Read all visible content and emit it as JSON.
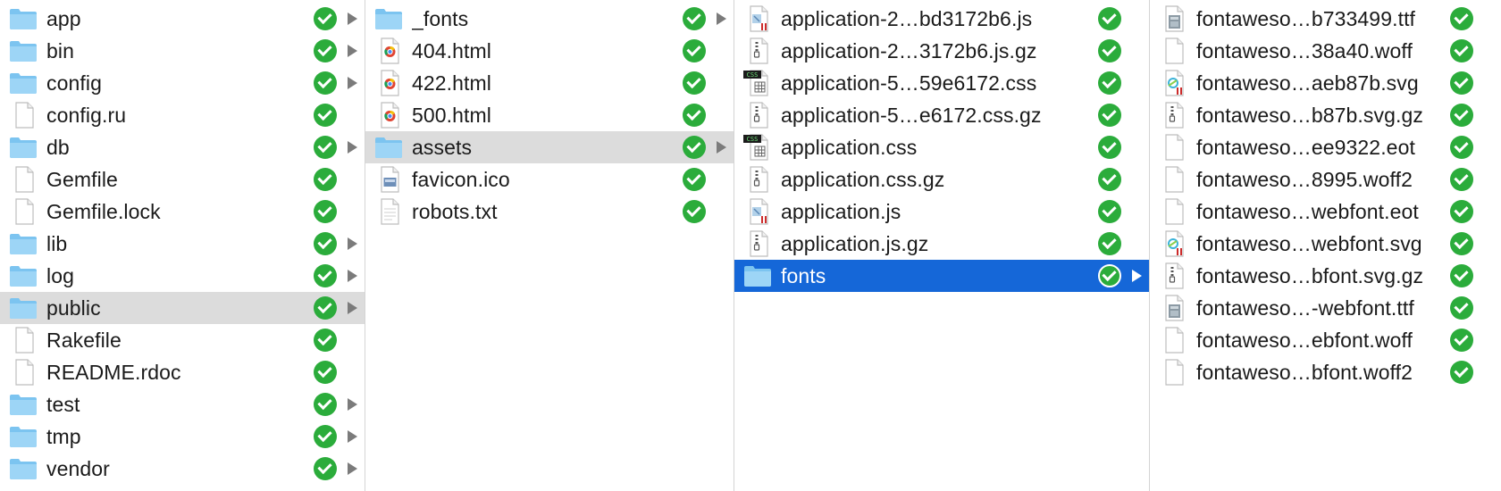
{
  "colors": {
    "folder": "#7cc4f0",
    "check": "#2bac3b",
    "selection_blue": "#1567d8",
    "selection_gray": "#dcdcdc"
  },
  "columns": [
    {
      "items": [
        {
          "name": "app",
          "kind": "folder",
          "arrow": true,
          "state": ""
        },
        {
          "name": "bin",
          "kind": "folder",
          "arrow": true,
          "state": ""
        },
        {
          "name": "config",
          "kind": "folder",
          "arrow": true,
          "state": ""
        },
        {
          "name": "config.ru",
          "kind": "file",
          "arrow": false,
          "state": ""
        },
        {
          "name": "db",
          "kind": "folder",
          "arrow": true,
          "state": ""
        },
        {
          "name": "Gemfile",
          "kind": "file",
          "arrow": false,
          "state": ""
        },
        {
          "name": "Gemfile.lock",
          "kind": "file",
          "arrow": false,
          "state": ""
        },
        {
          "name": "lib",
          "kind": "folder",
          "arrow": true,
          "state": ""
        },
        {
          "name": "log",
          "kind": "folder",
          "arrow": true,
          "state": ""
        },
        {
          "name": "public",
          "kind": "folder",
          "arrow": true,
          "state": "gray"
        },
        {
          "name": "Rakefile",
          "kind": "file",
          "arrow": false,
          "state": ""
        },
        {
          "name": "README.rdoc",
          "kind": "file",
          "arrow": false,
          "state": ""
        },
        {
          "name": "test",
          "kind": "folder",
          "arrow": true,
          "state": ""
        },
        {
          "name": "tmp",
          "kind": "folder",
          "arrow": true,
          "state": ""
        },
        {
          "name": "vendor",
          "kind": "folder",
          "arrow": true,
          "state": ""
        }
      ]
    },
    {
      "items": [
        {
          "name": "_fonts",
          "kind": "folder",
          "arrow": true,
          "state": ""
        },
        {
          "name": "404.html",
          "kind": "html",
          "arrow": false,
          "state": ""
        },
        {
          "name": "422.html",
          "kind": "html",
          "arrow": false,
          "state": ""
        },
        {
          "name": "500.html",
          "kind": "html",
          "arrow": false,
          "state": ""
        },
        {
          "name": "assets",
          "kind": "folder",
          "arrow": true,
          "state": "gray"
        },
        {
          "name": "favicon.ico",
          "kind": "ico",
          "arrow": false,
          "state": ""
        },
        {
          "name": "robots.txt",
          "kind": "txt",
          "arrow": false,
          "state": ""
        }
      ]
    },
    {
      "items": [
        {
          "name": "application-2…bd3172b6.js",
          "kind": "js",
          "arrow": false,
          "state": ""
        },
        {
          "name": "application-2…3172b6.js.gz",
          "kind": "gz",
          "arrow": false,
          "state": ""
        },
        {
          "name": "application-5…59e6172.css",
          "kind": "css",
          "arrow": false,
          "state": ""
        },
        {
          "name": "application-5…e6172.css.gz",
          "kind": "gz",
          "arrow": false,
          "state": ""
        },
        {
          "name": "application.css",
          "kind": "css",
          "arrow": false,
          "state": ""
        },
        {
          "name": "application.css.gz",
          "kind": "gz",
          "arrow": false,
          "state": ""
        },
        {
          "name": "application.js",
          "kind": "js",
          "arrow": false,
          "state": ""
        },
        {
          "name": "application.js.gz",
          "kind": "gz",
          "arrow": false,
          "state": ""
        },
        {
          "name": "fonts",
          "kind": "folder",
          "arrow": true,
          "state": "blue"
        }
      ]
    },
    {
      "items": [
        {
          "name": "fontaweso…b733499.ttf",
          "kind": "ttf",
          "arrow": false,
          "state": ""
        },
        {
          "name": "fontaweso…38a40.woff",
          "kind": "file",
          "arrow": false,
          "state": ""
        },
        {
          "name": "fontaweso…aeb87b.svg",
          "kind": "svg",
          "arrow": false,
          "state": ""
        },
        {
          "name": "fontaweso…b87b.svg.gz",
          "kind": "gz",
          "arrow": false,
          "state": ""
        },
        {
          "name": "fontaweso…ee9322.eot",
          "kind": "file",
          "arrow": false,
          "state": ""
        },
        {
          "name": "fontaweso…8995.woff2",
          "kind": "file",
          "arrow": false,
          "state": ""
        },
        {
          "name": "fontaweso…webfont.eot",
          "kind": "file",
          "arrow": false,
          "state": ""
        },
        {
          "name": "fontaweso…webfont.svg",
          "kind": "svg",
          "arrow": false,
          "state": ""
        },
        {
          "name": "fontaweso…bfont.svg.gz",
          "kind": "gz",
          "arrow": false,
          "state": ""
        },
        {
          "name": "fontaweso…-webfont.ttf",
          "kind": "ttf",
          "arrow": false,
          "state": ""
        },
        {
          "name": "fontaweso…ebfont.woff",
          "kind": "file",
          "arrow": false,
          "state": ""
        },
        {
          "name": "fontaweso…bfont.woff2",
          "kind": "file",
          "arrow": false,
          "state": ""
        }
      ]
    }
  ]
}
